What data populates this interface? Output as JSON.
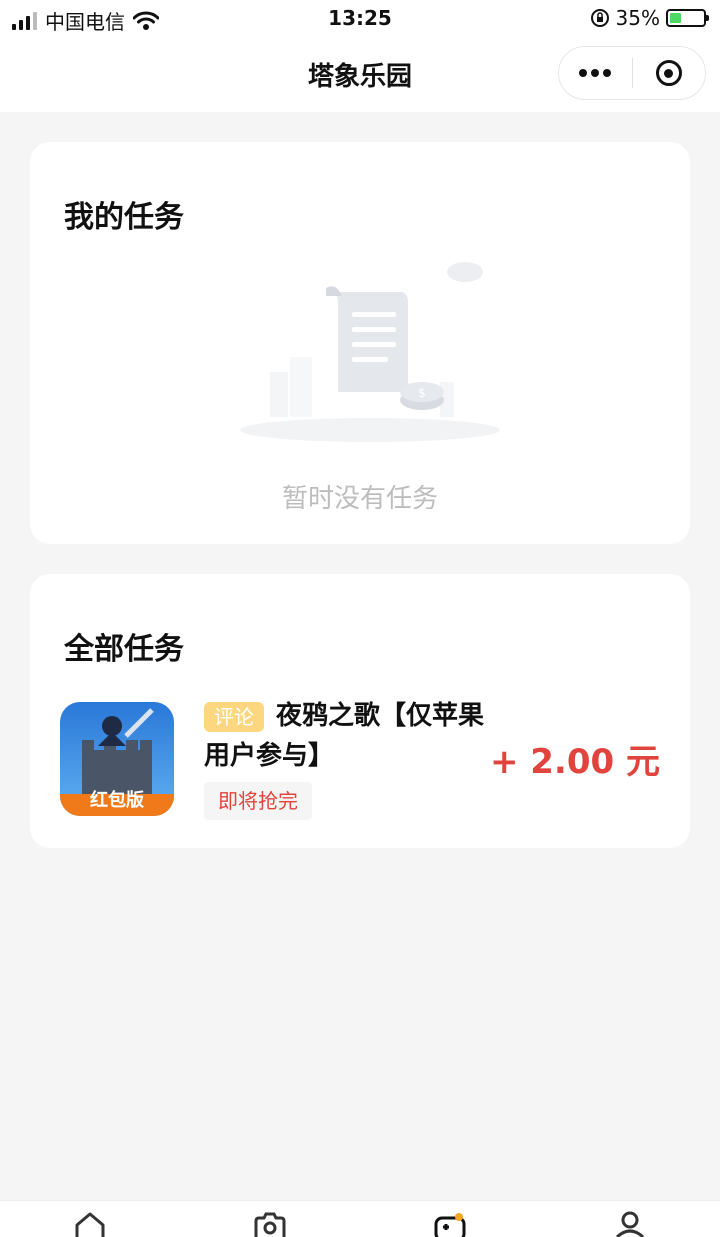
{
  "status_bar": {
    "carrier": "中国电信",
    "time": "13:25",
    "battery": "35%",
    "battery_level": 0.35
  },
  "nav": {
    "title": "塔象乐园"
  },
  "my_tasks": {
    "title": "我的任务",
    "empty_text": "暂时没有任务"
  },
  "all_tasks": {
    "title": "全部任务",
    "items": [
      {
        "tag": "评论",
        "title": "夜鸦之歌【仅苹果用户参与】",
        "status": "即将抢完",
        "reward": "+ 2.00 元",
        "icon_badge": "红包版"
      }
    ]
  },
  "tab_bar": {
    "icons": [
      "home-icon",
      "camera-icon",
      "game-icon",
      "user-icon"
    ],
    "active_index": 2
  },
  "colors": {
    "accent_red": "#e0443c",
    "tag_yellow": "#fcd77f",
    "battery_green": "#4cd964"
  }
}
